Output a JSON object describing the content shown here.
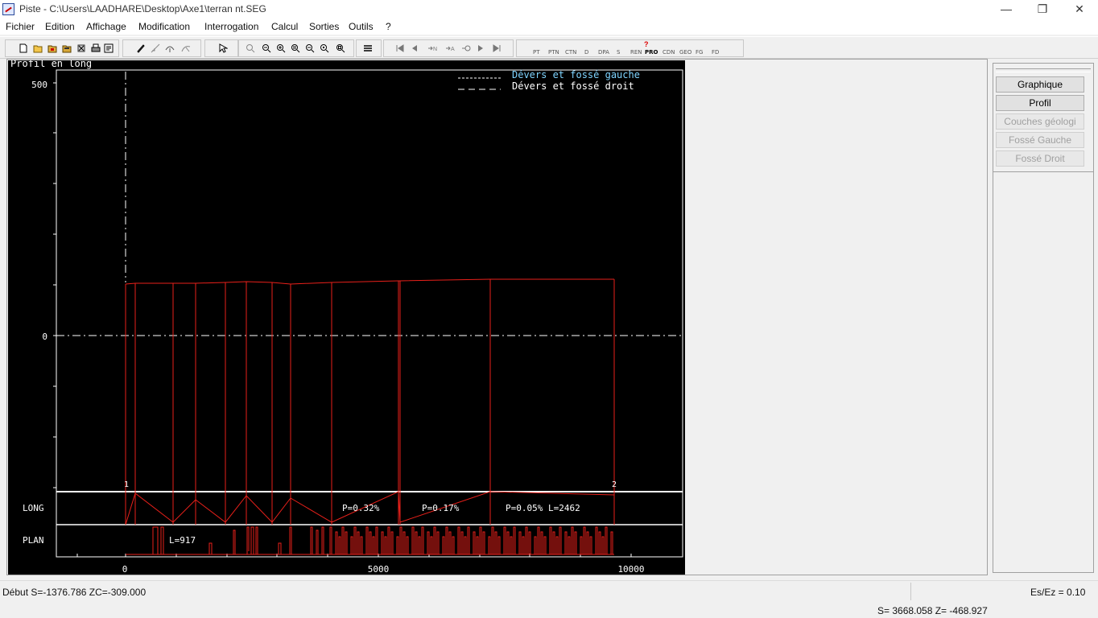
{
  "window": {
    "title": "Piste - C:\\Users\\LAADHARE\\Desktop\\Axe1\\terran nt.SEG",
    "minimize": "—",
    "restore": "❐",
    "close": "✕"
  },
  "menu": [
    "Fichier",
    "Edition",
    "Affichage",
    "Modification",
    "Interrogation",
    "Calcul",
    "Sorties",
    "Outils",
    "?"
  ],
  "toolbar": {
    "labels": [
      "PT",
      "PTN",
      "CTN",
      "D",
      "DPA",
      "S",
      "REN",
      "PRO",
      "CDN",
      "GEO",
      "FG",
      "FD"
    ],
    "help_glyph": "?"
  },
  "plot": {
    "title": "Profil en long",
    "y_labels": [
      "500",
      "0"
    ],
    "x_labels": [
      "0",
      "5000",
      "10000"
    ],
    "legend": [
      "Dévers et fossé gauche",
      "Dévers et fossé droit"
    ],
    "band_long": "LONG",
    "band_plan": "PLAN",
    "point_labels": [
      "1",
      "2"
    ],
    "long_labels": [
      "P=0.32%",
      "P=0.17%",
      "P=0.05% L=2462"
    ],
    "plan_label": "L=917",
    "colors": {
      "profile": "#e8201a",
      "legend_left": "#7fd4ff",
      "text": "#ffffff"
    }
  },
  "sidebar": {
    "buttons": [
      "Graphique",
      "Profil",
      "Couches géologi",
      "Fossé Gauche",
      "Fossé Droit"
    ]
  },
  "status": {
    "debut": "Début S=-1376.786 ZC=-309.000",
    "ratio": "Es/Ez = 0.10",
    "coords": "S= 3668.058  Z= -468.927"
  }
}
